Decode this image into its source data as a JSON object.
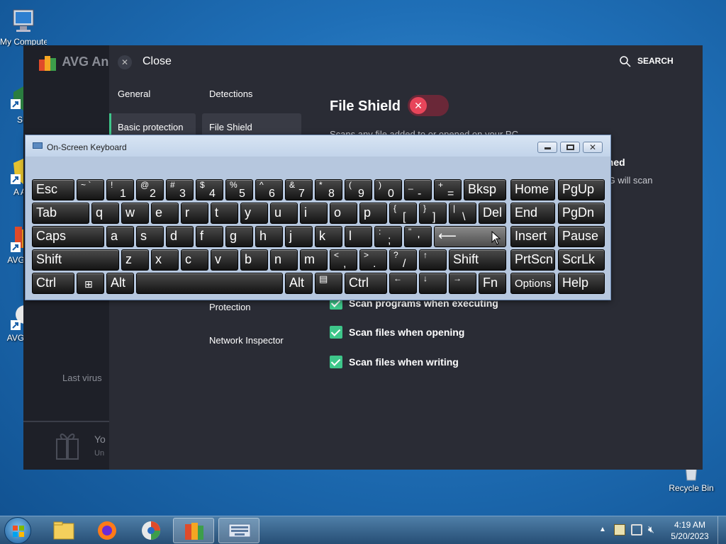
{
  "desktop": {
    "icons": [
      {
        "label": "My Computer"
      },
      {
        "label": "SM"
      },
      {
        "label": "A Ant"
      },
      {
        "label": "AVG A F"
      },
      {
        "label": "AVG Bro"
      },
      {
        "label": "Recycle Bin"
      }
    ]
  },
  "avg": {
    "logo": "AVG An",
    "close_label": "Close",
    "search_label": "SEARCH",
    "tabs": [
      "General",
      "Detections"
    ],
    "left_items": [
      "Basic protection",
      "File Shield"
    ],
    "lower_items": [
      "Protection",
      "Network Inspector"
    ],
    "section_title": "File Shield",
    "section_desc": "Scans any file added to or opened on your PC",
    "partial_right": "ched",
    "partial_right2": "VG will scan",
    "options": [
      "Scan programs when executing",
      "Scan files when opening",
      "Scan files when writing"
    ],
    "last_virus": "Last virus",
    "promo_line1": "Yo",
    "promo_line2": "Un"
  },
  "osk": {
    "title": "On-Screen Keyboard"
  },
  "taskbar": {
    "time": "4:19 AM",
    "date": "5/20/2023"
  }
}
